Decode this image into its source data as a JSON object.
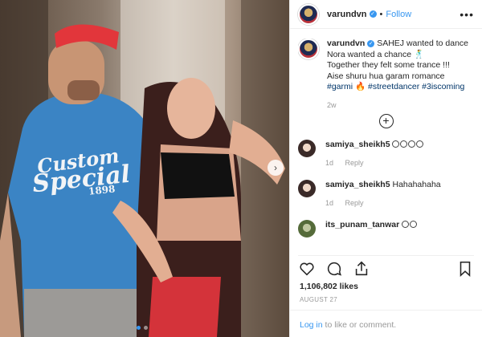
{
  "header": {
    "username": "varundvn",
    "separator": "•",
    "follow_label": "Follow",
    "more_label": "•••"
  },
  "caption": {
    "username": "varundvn",
    "line1": "SAHEJ wanted to dance",
    "line2": "Nora wanted a chance 🕺",
    "line3": "Together they felt some trance !!!",
    "line4": "Aise shuru hua garam romance",
    "hashtags": [
      "#garmi",
      "🔥",
      "#streetdancer",
      "#3iscoming"
    ],
    "age": "2w",
    "load_more": "+"
  },
  "comments": [
    {
      "username": "samiya_sheikh5",
      "text": "",
      "emoji_count": 4,
      "age": "1d",
      "reply": "Reply"
    },
    {
      "username": "samiya_sheikh5",
      "text": "Hahahahaha",
      "emoji_count": 0,
      "age": "1d",
      "reply": "Reply"
    },
    {
      "username": "its_punam_tanwar",
      "text": "",
      "emoji_count": 2,
      "age": "",
      "reply": ""
    }
  ],
  "likes": "1,106,802 likes",
  "date": "AUGUST 27",
  "login": {
    "link": "Log in",
    "rest": " to like or comment."
  },
  "media": {
    "shirt_line1": "Custom",
    "shirt_line2": "Special",
    "shirt_line3": "1898",
    "carousel_index": 1,
    "carousel_count": 2
  },
  "colors": {
    "accent": "#3897f0",
    "hashtag": "#003569",
    "muted": "#999999"
  }
}
